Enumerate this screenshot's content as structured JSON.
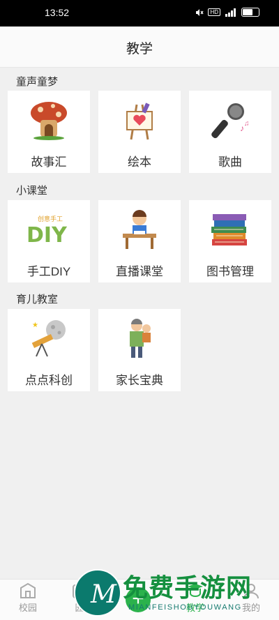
{
  "status_bar": {
    "time": "13:52",
    "network_label": "HD"
  },
  "header": {
    "title": "教学"
  },
  "sections": [
    {
      "title": "童声童梦",
      "items": [
        {
          "label": "故事汇",
          "icon": "mushroom-house-icon"
        },
        {
          "label": "绘本",
          "icon": "easel-heart-icon"
        },
        {
          "label": "歌曲",
          "icon": "microphone-icon"
        }
      ]
    },
    {
      "title": "小课堂",
      "items": [
        {
          "label": "手工DIY",
          "icon": "diy-text-icon",
          "icon_text": "DIY",
          "icon_caption": "创意手工"
        },
        {
          "label": "直播课堂",
          "icon": "student-desk-icon"
        },
        {
          "label": "图书管理",
          "icon": "book-stack-icon"
        }
      ]
    },
    {
      "title": "育儿教室",
      "items": [
        {
          "label": "点点科创",
          "icon": "telescope-moon-icon"
        },
        {
          "label": "家长宝典",
          "icon": "parent-child-icon"
        }
      ]
    }
  ],
  "bottom_nav": [
    {
      "label": "校园",
      "icon": "school-icon"
    },
    {
      "label": "园",
      "icon": "garden-icon"
    },
    {
      "label": "教学",
      "icon": "teaching-icon"
    },
    {
      "label": "我的",
      "icon": "profile-icon"
    }
  ],
  "watermark": {
    "text": "免费手游网",
    "url": "MIANFEISHOUYOUWANG",
    "logo_letter": "M"
  },
  "colors": {
    "header_bg": "#fafafa",
    "page_bg": "#f0f0f0",
    "card_bg": "#ffffff",
    "watermark_green": "#15903f"
  }
}
